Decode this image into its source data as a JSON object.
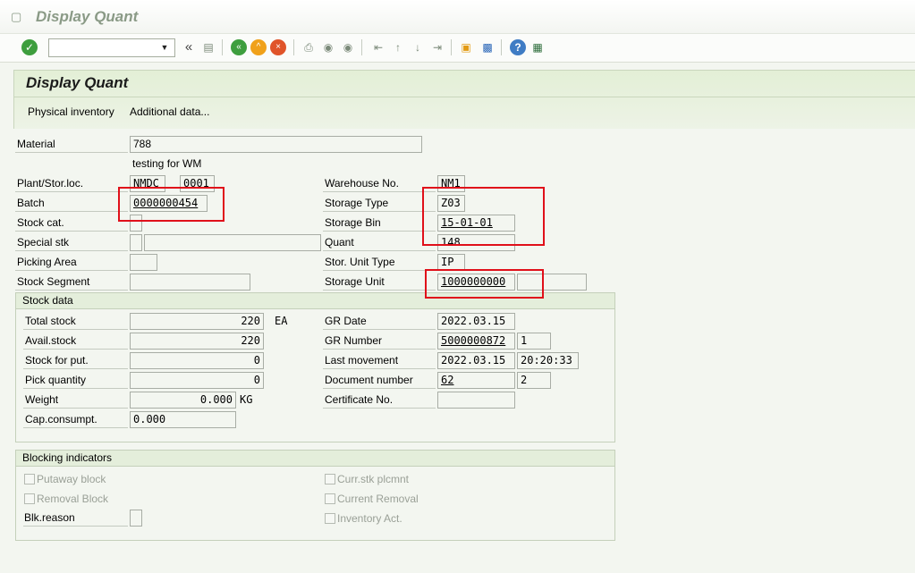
{
  "window": {
    "title": "Display Quant"
  },
  "toolbar": {
    "command_value": "",
    "buttons": [
      "enter-icon",
      "back-double-icon",
      "save-icon",
      "back-icon",
      "exit-icon",
      "cancel-icon",
      "print-icon",
      "find-icon",
      "find-next-icon",
      "first-page-icon",
      "prev-page-icon",
      "next-page-icon",
      "last-page-icon",
      "create-session-icon",
      "shortcut-icon",
      "help-icon",
      "customize-icon"
    ]
  },
  "header": {
    "title": "Display Quant",
    "menu": [
      "Physical inventory",
      "Additional data..."
    ]
  },
  "fields": {
    "material_label": "Material",
    "material_value": "788",
    "material_desc": "testing for WM",
    "plant_label": "Plant/Stor.loc.",
    "plant_value": "NMDC",
    "storloc_value": "0001",
    "batch_label": "Batch",
    "batch_value": "0000000454",
    "stockcat_label": "Stock cat.",
    "stockcat_value": "",
    "specialstk_label": "Special stk",
    "specialstk_value": "",
    "specialstk_value2": "",
    "pickarea_label": "Picking Area",
    "pickarea_value": "",
    "stockseg_label": "Stock Segment",
    "stockseg_value": "",
    "warehouse_label": "Warehouse No.",
    "warehouse_value": "NM1",
    "stortype_label": "Storage Type",
    "stortype_value": "Z03",
    "storbin_label": "Storage Bin",
    "storbin_value": "15-01-01",
    "quant_label": "Quant",
    "quant_value": "148",
    "suttype_label": "Stor. Unit Type",
    "suttype_value": "IP",
    "storunit_label": "Storage Unit",
    "storunit_value": "1000000000",
    "storunit_value2": ""
  },
  "stock_data": {
    "title": "Stock data",
    "total_label": "Total stock",
    "total_value": "220",
    "total_unit": "EA",
    "avail_label": "Avail.stock",
    "avail_value": "220",
    "put_label": "Stock for put.",
    "put_value": "0",
    "pick_label": "Pick quantity",
    "pick_value": "0",
    "weight_label": "Weight",
    "weight_value": "0.000",
    "weight_unit": "KG",
    "cap_label": "Cap.consumpt.",
    "cap_value": "0.000",
    "grdate_label": "GR Date",
    "grdate_value": "2022.03.15",
    "grnum_label": "GR Number",
    "grnum_value": "5000000872",
    "grnum_item": "1",
    "lastmov_label": "Last movement",
    "lastmov_date": "2022.03.15",
    "lastmov_time": "20:20:33",
    "docnum_label": "Document number",
    "docnum_value": "62",
    "docnum_item": "2",
    "cert_label": "Certificate No.",
    "cert_value": ""
  },
  "blocking": {
    "title": "Blocking indicators",
    "putaway": "Putaway block",
    "removal": "Removal Block",
    "blkreason_label": "Blk.reason",
    "blkreason_value": "",
    "currstk": "Curr.stk plcmnt",
    "currremoval": "Current Removal",
    "inventory": "Inventory Act."
  },
  "colors": {
    "highlight": "#e0101a",
    "header_bg": "#e3efd6",
    "page_bg": "#f3f6f0"
  }
}
